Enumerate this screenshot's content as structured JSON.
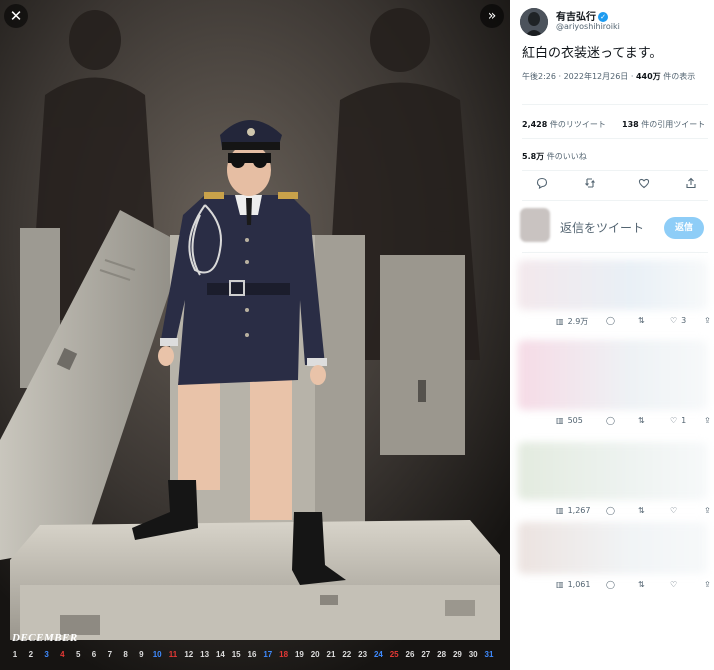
{
  "media": {
    "close_icon": "close-icon",
    "expand_icon": "expand-icon",
    "calendar_month": "DECEMBER",
    "calendar_days": [
      "1",
      "2",
      "3",
      "4",
      "5",
      "6",
      "7",
      "8",
      "9",
      "10",
      "11",
      "12",
      "13",
      "14",
      "15",
      "16",
      "17",
      "18",
      "19",
      "20",
      "21",
      "22",
      "23",
      "24",
      "25",
      "26",
      "27",
      "28",
      "29",
      "30",
      "31"
    ],
    "calendar_colors": {
      "sunday": "#e53935",
      "saturday": "#3f8bff",
      "default": "#dddddd"
    }
  },
  "tweet": {
    "author_name": "有吉弘行",
    "author_handle": "@ariyoshihiroiki",
    "text": "紅白の衣装迷ってます。",
    "time": "午後2:26 · 2022年12月26日 · ",
    "views_count": "440万",
    "views_label": " 件の表示",
    "retweets_count": "2,428",
    "retweets_label": " 件のリツイート",
    "quotes_count": "138",
    "quotes_label": " 件の引用ツイート",
    "likes_count": "5.8万",
    "likes_label": " 件のいいね"
  },
  "reply": {
    "placeholder": "返信をツイート",
    "button": "返信"
  },
  "replies": [
    {
      "views": "2.9万",
      "likes": "3"
    },
    {
      "views": "505",
      "likes": "1"
    },
    {
      "views": "1,267",
      "likes": ""
    },
    {
      "views": "1,061",
      "likes": ""
    }
  ],
  "colors": {
    "accent": "#1d9bf0",
    "accent_disabled": "#8ecdf7"
  }
}
